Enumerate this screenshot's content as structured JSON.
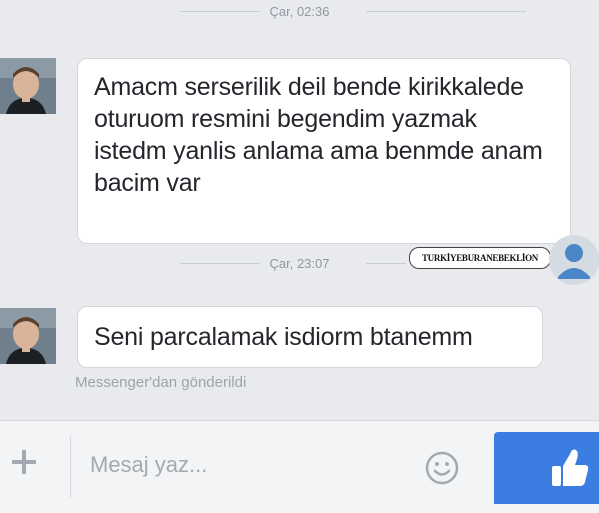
{
  "thread": {
    "timestamp_1": "Çar, 02:36",
    "timestamp_2": "Çar, 23:07",
    "messages": [
      {
        "text": "Amacm serserilik deil bende kirikkalede oturuom resmini begendim yazmak istedm yanlis anlama ama benmde anam bacim var"
      },
      {
        "text": "Seni parcalamak isdiorm btanemm"
      }
    ],
    "sent_via": "Messenger'dan gönderildi"
  },
  "watermark": {
    "text": "TURKİYEBURANEBEKLİON"
  },
  "composer": {
    "placeholder": "Mesaj yaz...",
    "plus_icon": "plus-icon",
    "emoji_icon": "smiley-icon",
    "like_icon": "thumbs-up-icon"
  },
  "colors": {
    "background": "#e9eaed",
    "bubble": "#ffffff",
    "like_button": "#3b7de0",
    "muted_text": "#9197a3"
  }
}
